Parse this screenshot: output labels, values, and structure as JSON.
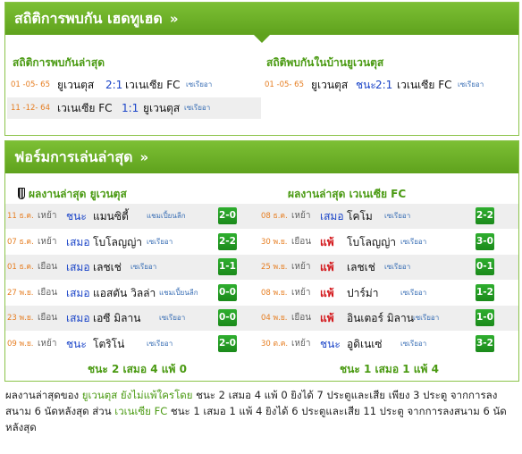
{
  "h2h": {
    "header": "สถิติการพบกัน เฮดทูเฮด",
    "left_title": "สถิติการพบกันล่าสุด",
    "right_title": "สถิติพบกันในบ้านยูเวนตุส",
    "left_rows": [
      {
        "date": "01 -05- 65",
        "home": "ยูเวนตุส",
        "score": "2:1",
        "away": "เวเนเซีย FC",
        "league": "เซเรียอา"
      },
      {
        "date": "11 -12- 64",
        "home": "เวเนเซีย FC",
        "score": "1:1",
        "away": "ยูเวนตุส",
        "league": "เซเรียอา"
      }
    ],
    "right_rows": [
      {
        "date": "01 -05- 65",
        "home": "ยูเวนตุส",
        "result": "ชนะ",
        "score": "2:1",
        "away": "เวเนเซีย FC",
        "league": "เซเรียอา"
      }
    ]
  },
  "form": {
    "header": "ฟอร์มการเล่นล่าสุด",
    "left_title": "ผลงานล่าสุด ยูเวนตุส",
    "right_title": "ผลงานล่าสุด เวเนเซีย FC",
    "left_rows": [
      {
        "date": "11 ธ.ค.",
        "venue": "เหย้า",
        "result": "ชนะ",
        "opponent": "แมนซิตี้",
        "league": "แชมเปี้ยนลีก",
        "score": "2-0"
      },
      {
        "date": "07 ธ.ค.",
        "venue": "เหย้า",
        "result": "เสมอ",
        "opponent": "โบโลญญ่า",
        "league": "เซเรียอา",
        "score": "2-2"
      },
      {
        "date": "01 ธ.ค.",
        "venue": "เยือน",
        "result": "เสมอ",
        "opponent": "เลชเช่",
        "league": "เซเรียอา",
        "score": "1-1"
      },
      {
        "date": "27 พ.ย.",
        "venue": "เยือน",
        "result": "เสมอ",
        "opponent": "แอสตัน วิลล่า",
        "league": "แชมเปี้ยนลีก",
        "score": "0-0"
      },
      {
        "date": "23 พ.ย.",
        "venue": "เยือน",
        "result": "เสมอ",
        "opponent": "เอซี มิลาน",
        "league": "เซเรียอา",
        "score": "0-0"
      },
      {
        "date": "09 พ.ย.",
        "venue": "เหย้า",
        "result": "ชนะ",
        "opponent": "โตริโน่",
        "league": "เซเรียอา",
        "score": "2-0"
      }
    ],
    "right_rows": [
      {
        "date": "08 ธ.ค.",
        "venue": "เหย้า",
        "result": "เสมอ",
        "opponent": "โคโม",
        "league": "เซเรียอา",
        "score": "2-2"
      },
      {
        "date": "30 พ.ย.",
        "venue": "เยือน",
        "result": "แพ้",
        "opponent": "โบโลญญ่า",
        "league": "เซเรียอา",
        "score": "3-0"
      },
      {
        "date": "25 พ.ย.",
        "venue": "เหย้า",
        "result": "แพ้",
        "opponent": "เลชเช่",
        "league": "เซเรียอา",
        "score": "0-1"
      },
      {
        "date": "08 พ.ย.",
        "venue": "เหย้า",
        "result": "แพ้",
        "opponent": "ปาร์ม่า",
        "league": "เซเรียอา",
        "score": "1-2"
      },
      {
        "date": "04 พ.ย.",
        "venue": "เยือน",
        "result": "แพ้",
        "opponent": "อินเตอร์ มิลาน",
        "league": "เซเรียอา",
        "score": "1-0"
      },
      {
        "date": "30 ต.ค.",
        "venue": "เหย้า",
        "result": "ชนะ",
        "opponent": "อูดิเนเซ่",
        "league": "เซเรียอา",
        "score": "3-2"
      }
    ],
    "left_summary": "ชนะ 2 เสมอ 4 แพ้ 0",
    "right_summary": "ชนะ 1 เสมอ 1 แพ้ 4"
  },
  "note": {
    "p1": "ผลงานล่าสุดของ ",
    "team1": "ยูเวนตุส ยังไม่แพ้ใครโดย",
    "p2": " ชนะ 2 เสมอ 4 แพ้ 0 ยิงได้ 7 ประตูและเสีย เพียง 3 ประตู จากการลงสนาม 6 นัดหลังสุด ส่วน ",
    "team2": "เวเนเซีย FC",
    "p3": " ชนะ 1 เสมอ 1 แพ้ 4 ยิงได้ 6 ประตูและเสีย 11 ประตู จากการลงสนาม 6 นัดหลังสุด"
  },
  "colors": {
    "accent_green": "#6aae28",
    "badge_green": "#1f8f1f",
    "loss_red": "#d3161a",
    "score_blue": "#1a44c8",
    "date_orange": "#e67e22"
  },
  "icons": {
    "chevron": "double-chevron-right-icon",
    "club_crest": "juventus-crest-icon"
  }
}
